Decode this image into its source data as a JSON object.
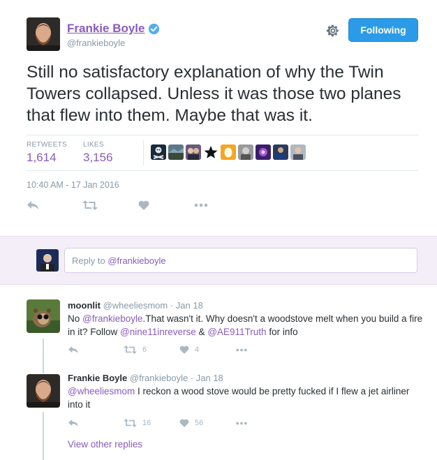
{
  "tweet": {
    "display_name": "Frankie Boyle",
    "handle": "@frankieboyle",
    "follow_label": "Following",
    "text": "Still no satisfactory explanation of why the Twin Towers collapsed. Unless it was those two planes that flew into them. Maybe that was it.",
    "retweets_label": "RETWEETS",
    "retweets": "1,614",
    "likes_label": "LIKES",
    "likes": "3,156",
    "timestamp": "10:40 AM - 17 Jan 2016",
    "icons": [
      "reply-icon",
      "retweet-icon",
      "heart-icon",
      "more-icon",
      "gear-icon",
      "verified-icon"
    ]
  },
  "colors": {
    "link": "#8a5bbd",
    "follow_button": "#2b9be7",
    "reply_bar": "#f3eef8",
    "muted": "#8899a6"
  },
  "reply_box": {
    "prefix": "Reply to ",
    "mention": "@frankieboyle"
  },
  "replies": [
    {
      "name": "moonlit",
      "handle": "@wheeliesmom",
      "date": "· Jan 18",
      "text_parts": {
        "p1": "No ",
        "m1": "@frankieboyle",
        "p2": ".That wasn't it. Why doesn't a woodstove melt when you build a fire in it? Follow ",
        "m2": "@nine11inreverse",
        "p3": " & ",
        "m3": "@AE911Truth",
        "p4": " for info"
      },
      "retweets": "6",
      "likes": "4"
    },
    {
      "name": "Frankie Boyle",
      "handle": "@frankieboyle",
      "date": "· Jan 18",
      "text_parts": {
        "m1": "@wheeliesmom",
        "p1": " I reckon a wood stove would be pretty fucked if I flew a jet airliner into it"
      },
      "retweets": "16",
      "likes": "56"
    }
  ],
  "view_other_replies": "View other replies"
}
